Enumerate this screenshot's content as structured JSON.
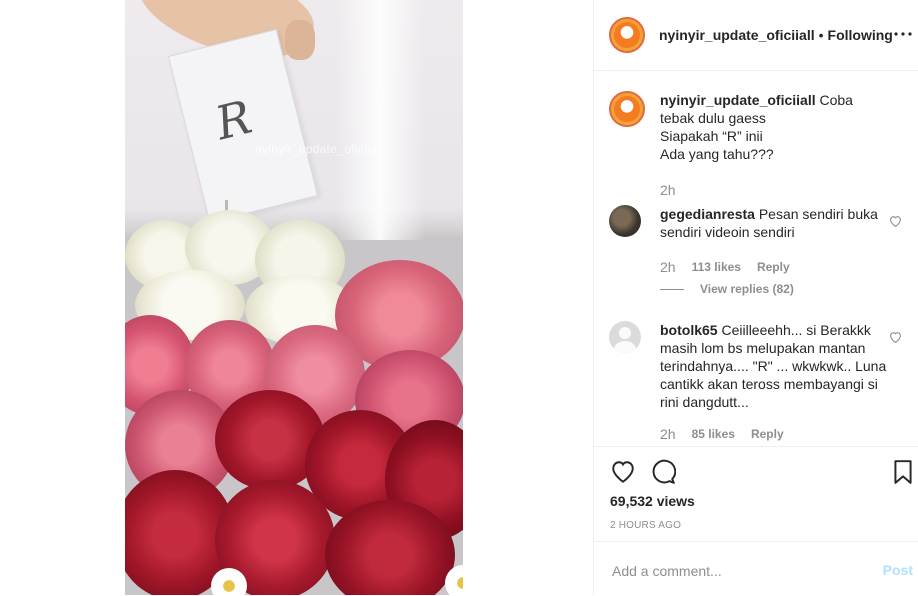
{
  "media": {
    "watermark": "nyinyir_update_oficiia",
    "card_letter": "R",
    "colors": {
      "rose_red": "#a3162a",
      "rose_pink": "#d9647a",
      "rose_white": "#f3f2e4"
    }
  },
  "header": {
    "username": "nyinyir_update_oficiiall",
    "separator": "•",
    "follow_label": "Following",
    "more_icon": "more-options-icon"
  },
  "caption": {
    "username": "nyinyir_update_oficiiall",
    "text_line1": "Coba tebak dulu gaess",
    "text_line2": "Siapakah “R” inii",
    "text_line3": "Ada yang tahu???",
    "time": "2h"
  },
  "comments": [
    {
      "username": "gegedianresta",
      "text": "Pesan sendiri buka sendiri videoin sendiri",
      "time": "2h",
      "likes": "113 likes",
      "reply_label": "Reply",
      "view_replies": "View replies (82)"
    },
    {
      "username": "botolk65",
      "text": "Ceiilleeehh... si Berakkk masih lom bs melupakan mantan terindahnya.... \"R\" ... wkwkwk.. Luna cantikk akan teross membayangi si rini dangdutt...",
      "time": "2h",
      "likes": "85 likes",
      "reply_label": "Reply"
    }
  ],
  "actions": {
    "views": "69,532 views",
    "posted_ago": "2 HOURS AGO"
  },
  "add_comment": {
    "placeholder": "Add a comment...",
    "post_label": "Post"
  }
}
